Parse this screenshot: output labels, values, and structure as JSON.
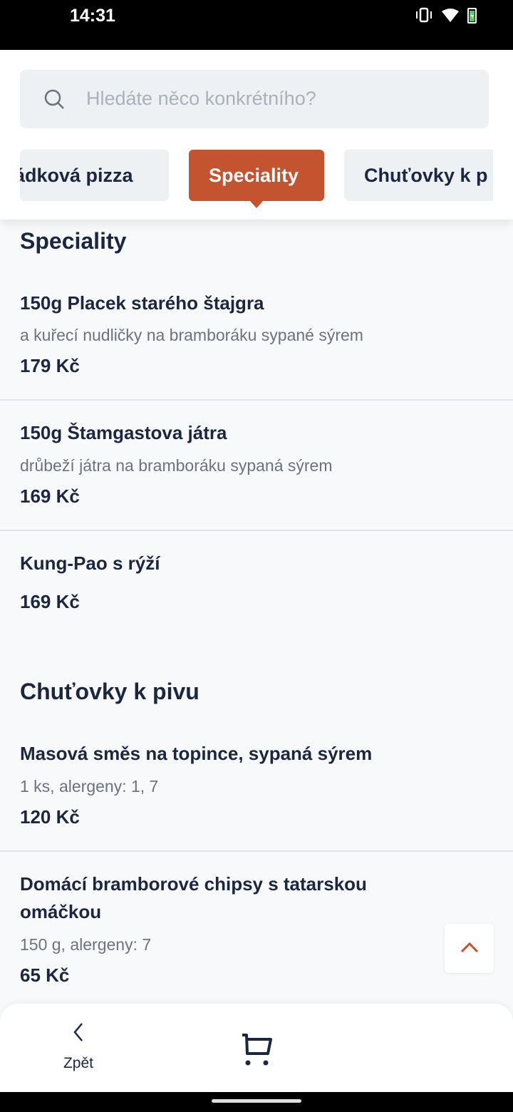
{
  "status_bar": {
    "time": "14:31",
    "icons": [
      "vibrate-icon",
      "wifi-icon",
      "battery-charging-icon"
    ]
  },
  "search": {
    "placeholder": "Hledáte něco konkrétního?",
    "icon": "search-icon"
  },
  "tabs": [
    {
      "label": "ádková pizza"
    },
    {
      "label": "Speciality",
      "active": true
    },
    {
      "label": "Chuťovky k p"
    }
  ],
  "accent_color": "#c4532f",
  "sections": [
    {
      "title": "Speciality",
      "items": [
        {
          "name": "150g Placek starého štajgra",
          "description": "a kuřecí nudličky na bramboráku sypané sýrem",
          "price": "179 Kč"
        },
        {
          "name": "150g Štamgastova játra",
          "description": "drůbeží játra na bramboráku sypaná sýrem",
          "price": "169 Kč"
        },
        {
          "name": "Kung-Pao s rýží",
          "price": "169 Kč"
        }
      ]
    },
    {
      "title": "Chuťovky k pivu",
      "items": [
        {
          "name": "Masová směs na topince, sypaná sýrem",
          "description": "1 ks, alergeny: 1, 7",
          "price": "120 Kč"
        },
        {
          "name": "Domácí bramborové chipsy s tatarskou omáčkou",
          "description": "150 g, alergeny: 7",
          "price": "65 Kč"
        }
      ]
    }
  ],
  "bottom_nav": {
    "back_label": "Zpět",
    "cart_icon": "cart-icon"
  }
}
